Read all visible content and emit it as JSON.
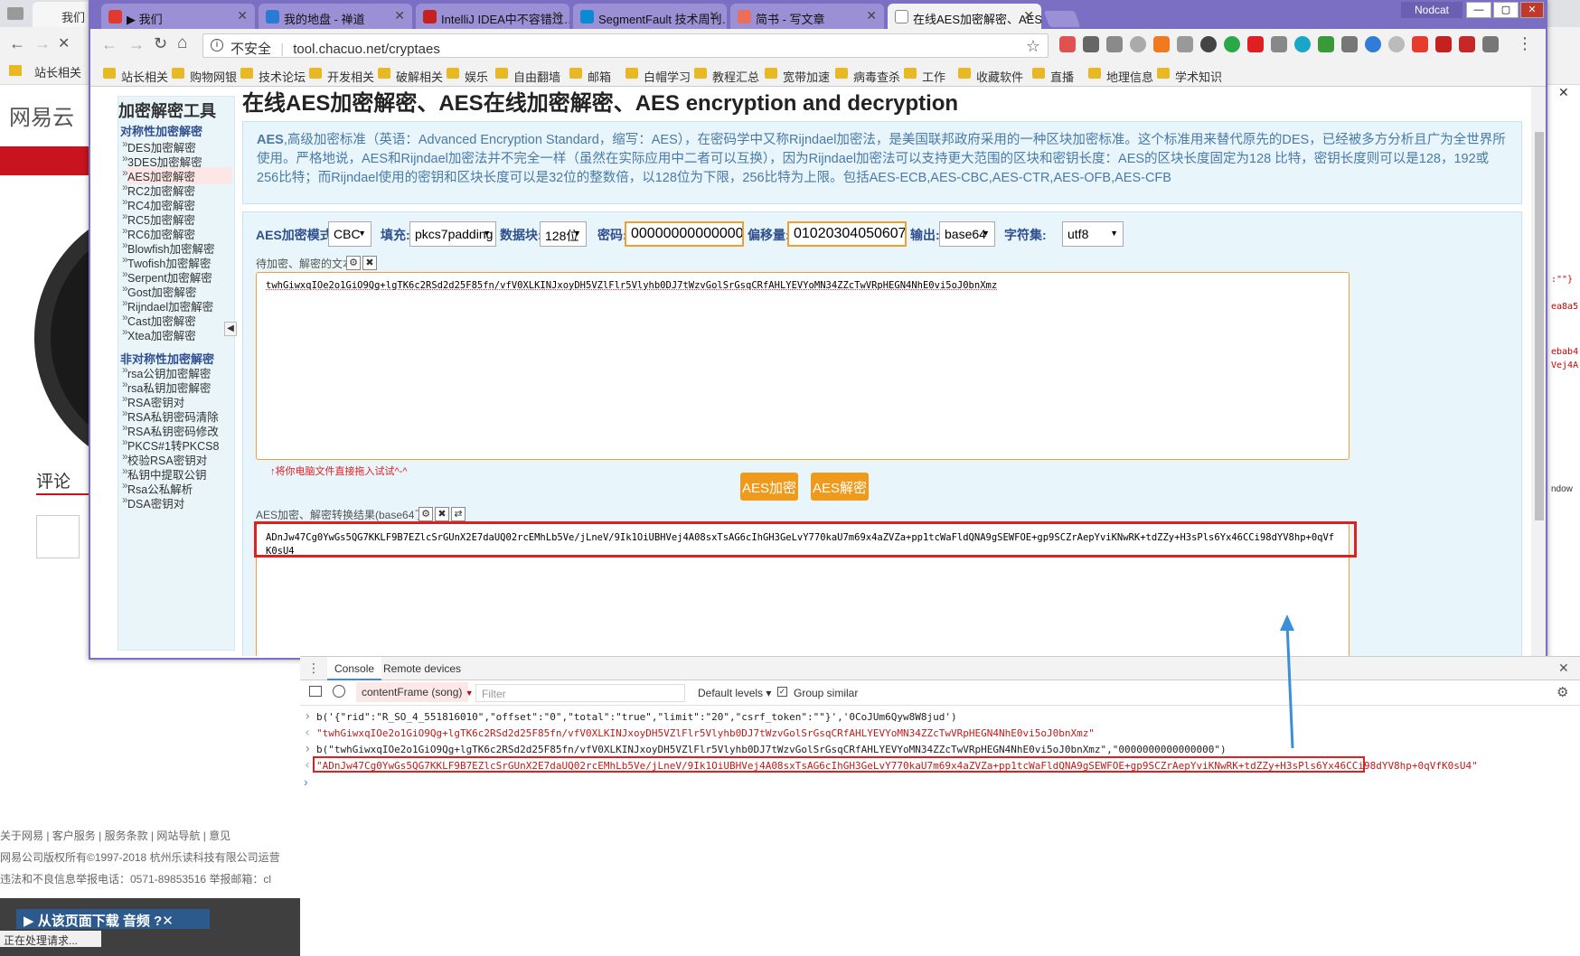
{
  "bg_window": {
    "tab_label": "我们",
    "bookmark_first": "站长相关",
    "logo_text": "网易云",
    "comment_label": "评论",
    "footer_links": "关于网易  |  客户服务  |  服务条款  |  网站导航  |  意见",
    "copyright": "网易公司版权所有©1997-2018    杭州乐读科技有限公司运营",
    "report": "违法和不良信息举报电话：0571-89853516    举报邮箱：cl",
    "download_bar": "从该页面下载 音频",
    "status_text": "正在处理请求..."
  },
  "window": {
    "user": "Nodcat",
    "tabs": [
      {
        "label": "▶ 我们",
        "color": "#e03a2e"
      },
      {
        "label": "我的地盘 - 禅道",
        "color": "#2a7bd6"
      },
      {
        "label": "IntelliJ IDEA中不容错过…",
        "color": "#c5221f"
      },
      {
        "label": "SegmentFault 技术周刊…",
        "color": "#0a8ad2"
      },
      {
        "label": "简书 - 写文章",
        "color": "#ea6f5a"
      },
      {
        "label": "在线AES加密解密、AES在…",
        "color": "#888888"
      }
    ],
    "security_label": "不安全",
    "url": "tool.chacuo.net/cryptaes"
  },
  "bookmarks": [
    "站长相关",
    "购物网银",
    "技术论坛",
    "开发相关",
    "破解相关",
    "娱乐",
    "自由翻墙",
    "邮箱",
    "白帽学习",
    "教程汇总",
    "宽带加速",
    "病毒查杀",
    "工作",
    "收藏软件",
    "直播",
    "地理信息",
    "学术知识"
  ],
  "sidebar": {
    "title": "加密解密工具",
    "symmetric_heading": "对称性加密解密",
    "symmetric_items": [
      "DES加密解密",
      "3DES加密解密",
      "AES加密解密",
      "RC2加密解密",
      "RC4加密解密",
      "RC5加密解密",
      "RC6加密解密",
      "Blowfish加密解密",
      "Twofish加密解密",
      "Serpent加密解密",
      "Gost加密解密",
      "Rijndael加密解密",
      "Cast加密解密",
      "Xtea加密解密"
    ],
    "asymmetric_heading": "非对称性加密解密",
    "asymmetric_items": [
      "rsa公钥加密解密",
      "rsa私钥加密解密",
      "RSA密钥对",
      "RSA私钥密码清除",
      "RSA私钥密码修改",
      "PKCS#1转PKCS8",
      "校验RSA密钥对",
      "私钥中提取公钥",
      "Rsa公私解析",
      "DSA密钥对"
    ],
    "collapse_glyph": "◀"
  },
  "page": {
    "title": "在线AES加密解密、AES在线加密解密、AES encryption and decryption",
    "intro_lead": "AES",
    "intro_text": ",高级加密标准（英语：Advanced Encryption Standard，缩写：AES），在密码学中又称Rijndael加密法，是美国联邦政府采用的一种区块加密标准。这个标准用来替代原先的DES，已经被多方分析且广为全世界所使用。严格地说，AES和Rijndael加密法并不完全一样（虽然在实际应用中二者可以互换），因为Rijndael加密法可以支持更大范围的区块和密钥长度：AES的区块长度固定为128 比特，密钥长度则可以是128，192或256比特；而Rijndael使用的密钥和区块长度可以是32位的整数倍，以128位为下限，256比特为上限。包括AES-ECB,AES-CBC,AES-CTR,AES-OFB,AES-CFB"
  },
  "form": {
    "mode_label": "AES加密模式:",
    "mode_value": "CBC",
    "padding_label": "填充:",
    "padding_value": "pkcs7padding",
    "block_label": "数据块:",
    "block_value": "128位",
    "password_label": "密码:",
    "password_value": "0000000000000000",
    "iv_label": "偏移量:",
    "iv_value": "0102030405060708",
    "output_label": "输出:",
    "output_value": "base64",
    "charset_label": "字符集:",
    "charset_value": "utf8",
    "input_label": "待加密、解密的文本:",
    "input_text": "twhGiwxqIOe2o1GiO9Qg+lgTK6c2RSd2d25F85fn/vfV0XLKINJxoyDH5VZlFlr5Vlyhb0DJ7tWzvGolSrGsqCRfAHLYEVYoMN34ZZcTwVRpHEGN4NhE0vi5oJ0bnXmz",
    "drop_hint": "↑将你电脑文件直接拖入试试^-^",
    "encrypt_button": "AES加密",
    "decrypt_button": "AES解密",
    "result_label": "AES加密、解密转换结果(base64了):",
    "result_text": "ADnJw47Cg0YwGs5QG7KKLF9B7EZlcSrGUnX2E7daUQ02rcEMhLb5Ve/jLneV/9Ik1OiUBHVej4A08sxTsAG6cIhGH3GeLvY770kaU7m69x4aZVZa+pp1tcWaFldQNA9gSEWFOE+gp9SCZrAepYviKNwRK+tdZZy+H3sPls6Yx46CCi98dYV8hp+0qVfK0sU4"
  },
  "devtools": {
    "tab_console": "Console",
    "tab_remote": "Remote devices",
    "context": "contentFrame (song)",
    "filter_placeholder": "Filter",
    "levels": "Default levels",
    "group_similar": "Group similar",
    "lines": [
      "b('{\"rid\":\"R_SO_4_551816010\",\"offset\":\"0\",\"total\":\"true\",\"limit\":\"20\",\"csrf_token\":\"\"}','0CoJUm6Qyw8W8jud')",
      "\"twhGiwxqIOe2o1GiO9Qg+lgTK6c2RSd2d25F85fn/vfV0XLKINJxoyDH5VZlFlr5Vlyhb0DJ7tWzvGolSrGsqCRfAHLYEVYoMN34ZZcTwVRpHEGN4NhE0vi5oJ0bnXmz\"",
      "b(\"twhGiwxqIOe2o1GiO9Qg+lgTK6c2RSd2d25F85fn/vfV0XLKINJxoyDH5VZlFlr5Vlyhb0DJ7tWzvGolSrGsqCRfAHLYEVYoMN34ZZcTwVRpHEGN4NhE0vi5oJ0bnXmz\",\"0000000000000000\")",
      "\"ADnJw47Cg0YwGs5QG7KKLF9B7EZlcSrGUnX2E7daUQ02rcEMhLb5Ve/jLneV/9Ik1OiUBHVej4A08sxTsAG6cIhGH3GeLvY770kaU7m69x4aZVZa+pp1tcWaFldQNA9gSEWFOE+gp9SCZrAepYviKNwRK+tdZZy+H3sPls6Yx46CCi98dYV8hp+0qVfK0sU4\""
    ]
  },
  "right_panel_snippets": [
    ":\"\"}",
    "ea8a5",
    "ebab4",
    "Vej4A",
    "ndow"
  ],
  "colors": {
    "accent": "#f09a1c",
    "window_frame": "#7b6fc4",
    "highlight": "#e02020",
    "arrow": "#3b8fd9"
  }
}
